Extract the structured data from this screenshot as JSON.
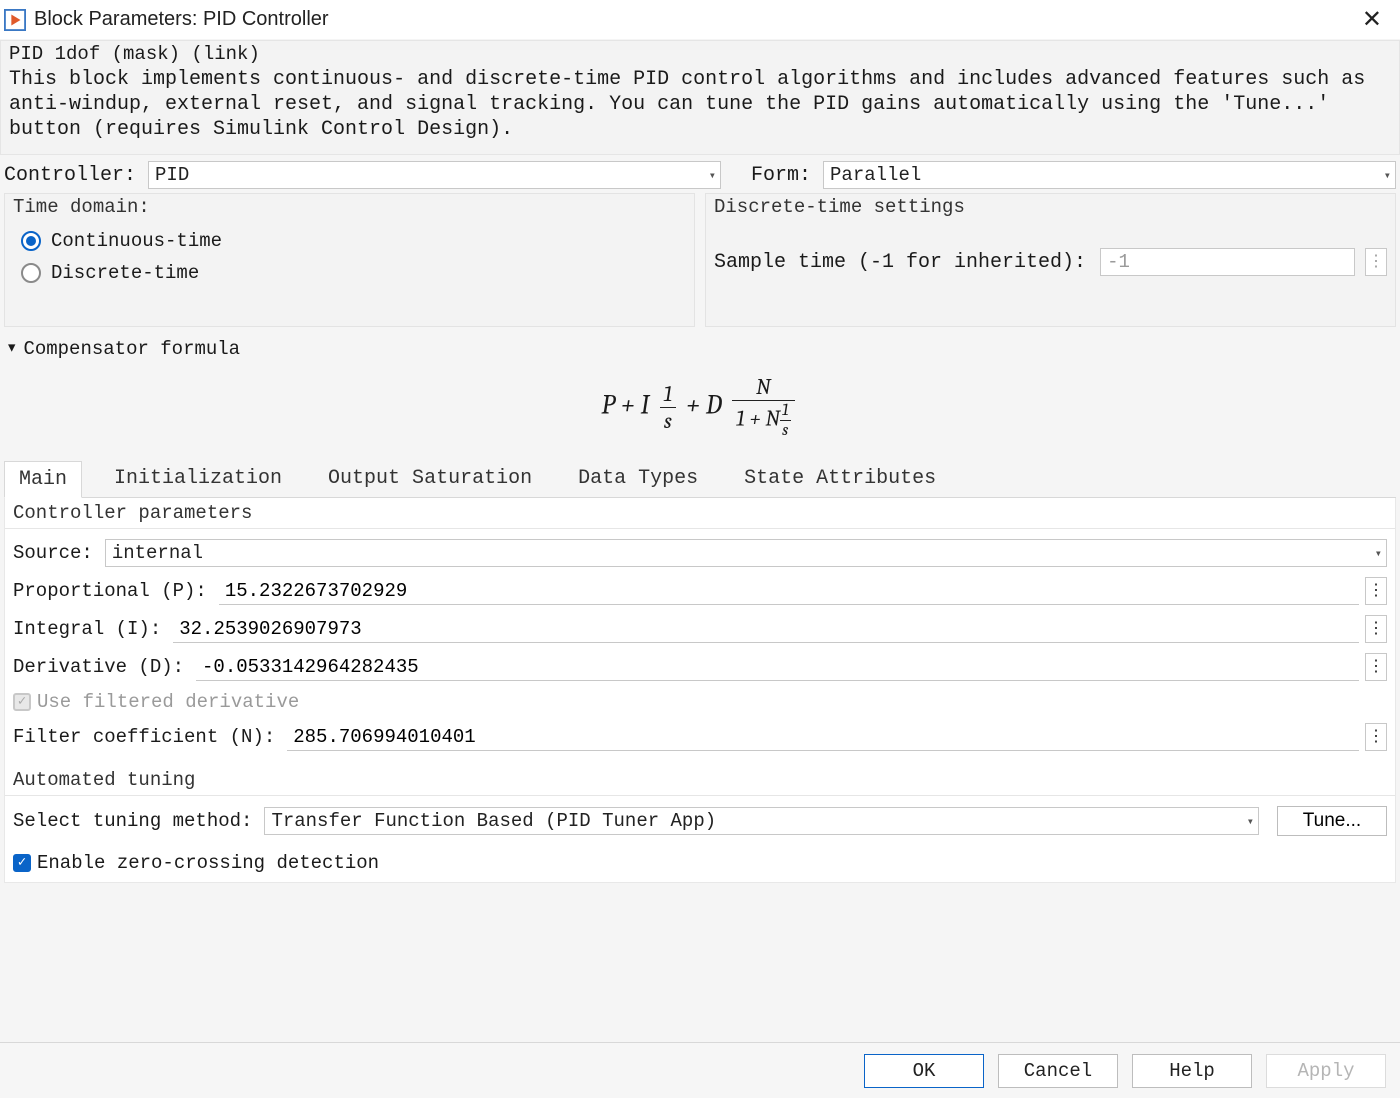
{
  "title": "Block Parameters: PID Controller",
  "mask_line": "PID 1dof (mask) (link)",
  "description": "This block implements continuous- and discrete-time PID control algorithms and includes advanced features such as anti-windup, external reset, and signal tracking. You can tune the PID gains automatically using the 'Tune...' button (requires Simulink Control Design).",
  "controller": {
    "label": "Controller:",
    "value": "PID"
  },
  "form": {
    "label": "Form:",
    "value": "Parallel"
  },
  "time_domain": {
    "legend": "Time domain:",
    "options": {
      "continuous": "Continuous-time",
      "discrete": "Discrete-time"
    }
  },
  "discrete": {
    "legend": "Discrete-time settings",
    "sample_label": "Sample time (-1 for inherited):",
    "sample_value": "-1"
  },
  "compensator_header": "Compensator formula",
  "tabs": {
    "main": "Main",
    "init": "Initialization",
    "output": "Output Saturation",
    "dtypes": "Data Types",
    "state": "State Attributes"
  },
  "ctrl_params": {
    "legend": "Controller parameters",
    "source_label": "Source:",
    "source_value": "internal",
    "p_label": "Proportional (P):",
    "p_value": "15.2322673702929",
    "i_label": "Integral (I):",
    "i_value": "32.2539026907973",
    "d_label": "Derivative (D):",
    "d_value": "-0.0533142964282435",
    "filtered_label": "Use filtered derivative",
    "n_label": "Filter coefficient (N):",
    "n_value": "285.706994010401"
  },
  "tuning": {
    "legend": "Automated tuning",
    "method_label": "Select tuning method:",
    "method_value": "Transfer Function Based (PID Tuner App)",
    "tune_btn": "Tune..."
  },
  "zero_cross": "Enable zero-crossing detection",
  "footer": {
    "ok": "OK",
    "cancel": "Cancel",
    "help": "Help",
    "apply": "Apply"
  }
}
